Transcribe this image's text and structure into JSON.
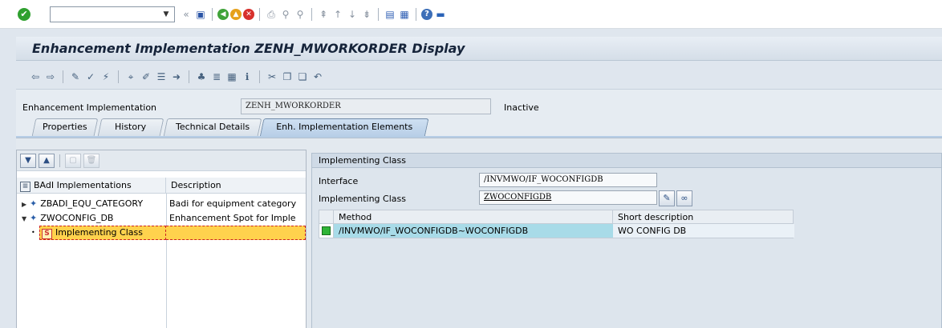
{
  "system_toolbar": {
    "command_field_value": "",
    "icons": [
      "enter-icon",
      "back-icon",
      "save-icon",
      "back-nav-icon",
      "exit-icon",
      "cancel-icon",
      "print-icon",
      "find-icon",
      "find-next-icon",
      "first-page-icon",
      "prev-page-icon",
      "next-page-icon",
      "last-page-icon",
      "new-session-icon",
      "shortcut-icon",
      "help-icon",
      "customize-icon"
    ]
  },
  "title": "Enhancement Implementation ZENH_MWORKORDER Display",
  "header": {
    "label": "Enhancement Implementation",
    "value": "ZENH_MWORKORDER",
    "status": "Inactive"
  },
  "tabs": [
    {
      "label": "Properties"
    },
    {
      "label": "History"
    },
    {
      "label": "Technical Details"
    },
    {
      "label": "Enh. Implementation Elements",
      "active": true
    }
  ],
  "tree": {
    "col1_header": "BAdI Implementations",
    "col2_header": "Description",
    "rows": [
      {
        "name": "ZBADI_EQU_CATEGORY",
        "description": "Badi for equipment category",
        "expanded": false
      },
      {
        "name": "ZWOCONFIG_DB",
        "description": "Enhancement Spot for Imple",
        "expanded": true
      },
      {
        "name": "Implementing Class",
        "description": "",
        "selected": true
      }
    ]
  },
  "detail": {
    "section_title": "Implementing Class",
    "interface_label": "Interface",
    "interface_value": "/INVMWO/IF_WOCONFIGDB",
    "impl_class_label": "Implementing Class",
    "impl_class_value": "ZWOCONFIGDB",
    "grid": {
      "col_method": "Method",
      "col_desc": "Short description",
      "rows": [
        {
          "method": "/INVMWO/IF_WOCONFIGDB~WOCONFIGDB",
          "desc": "WO CONFIG DB",
          "status": "green"
        }
      ]
    }
  },
  "colors": {
    "title_text": "#16243a",
    "selection": "#ffd24d",
    "method_cell": "#a8dbe8",
    "status_green": "#2fb437"
  }
}
